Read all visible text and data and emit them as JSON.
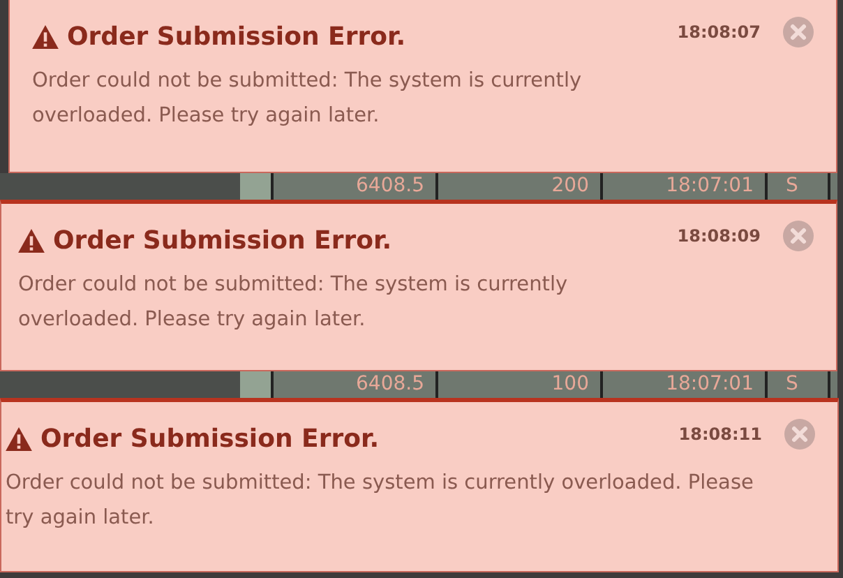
{
  "notifications": [
    {
      "title": "Order Submission Error.",
      "time": "18:08:07",
      "message": "Order could not be submitted: The system is currently overloaded. Please try again later.",
      "row": {
        "price": "6408.5",
        "quantity": "200",
        "time": "18:07:01",
        "side": "S"
      }
    },
    {
      "title": "Order Submission Error.",
      "time": "18:08:09",
      "message": "Order could not be submitted: The system is currently overloaded. Please try again later.",
      "row": {
        "price": "6408.5",
        "quantity": "100",
        "time": "18:07:01",
        "side": "S"
      }
    },
    {
      "title": "Order Submission Error.",
      "time": "18:08:11",
      "message": "Order could not be submitted: The system is currently overloaded. Please try again later."
    }
  ]
}
